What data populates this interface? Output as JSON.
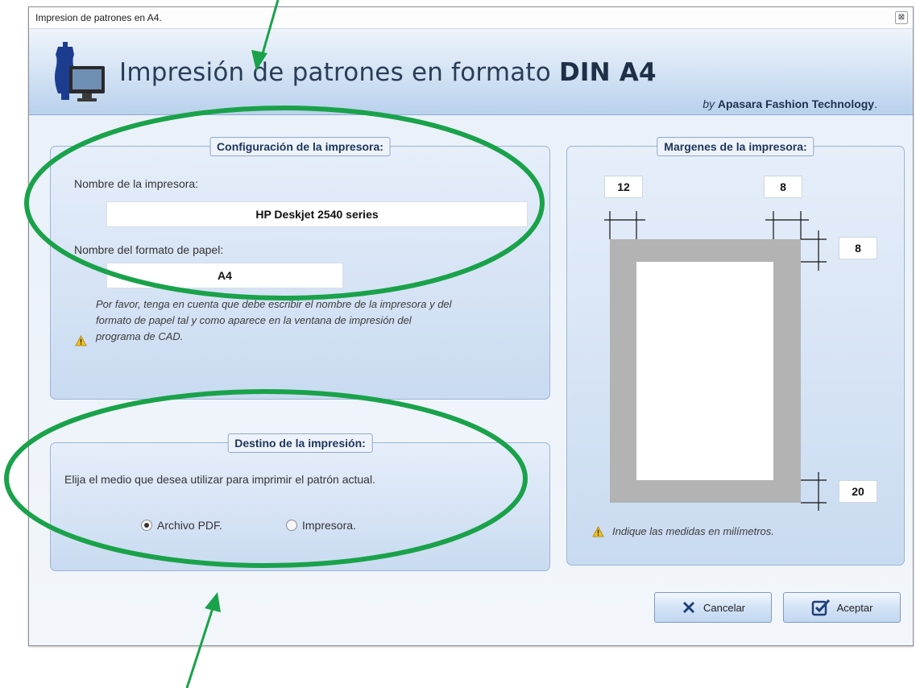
{
  "window": {
    "title": "Impresion de patrones en A4.",
    "close_glyph": "⊠"
  },
  "header": {
    "title_prefix": "Impresión de patrones en formato ",
    "title_bold": "DIN A4",
    "by": "by",
    "company": "Apasara Fashion Technology",
    "period": "."
  },
  "printer_config": {
    "legend": "Configuración de la impresora:",
    "printer_label": "Nombre de la impresora:",
    "printer_value": "HP Deskjet 2540 series",
    "paper_label": "Nombre del formato de papel:",
    "paper_value": "A4",
    "note_line1": "Por favor, tenga en cuenta que debe escribir el nombre de la impresora y del",
    "note_line2": "formato de papel tal y como aparece en la ventana de impresión del",
    "note_line3": "programa de CAD."
  },
  "destination": {
    "legend": "Destino de la impresión:",
    "instruction": "Elija el medio que desea utilizar para imprimir el patrón actual.",
    "options": [
      {
        "label": "Archivo PDF.",
        "selected": true
      },
      {
        "label": "Impresora.",
        "selected": false
      }
    ]
  },
  "margins": {
    "legend": "Margenes de la impresora:",
    "left": "12",
    "right": "8",
    "top": "8",
    "bottom": "20",
    "note": "Indique las medidas en milímetros."
  },
  "buttons": {
    "cancel": "Cancelar",
    "accept": "Aceptar"
  },
  "colors": {
    "annotation": "#1aa24a",
    "paper_border": "#b3b3b3",
    "warning": "#f2c01e"
  },
  "icons": {
    "cancel": "x-icon",
    "accept": "checkbox-icon",
    "warning": "warning-icon",
    "logo": "mannequin-monitor-icon"
  }
}
